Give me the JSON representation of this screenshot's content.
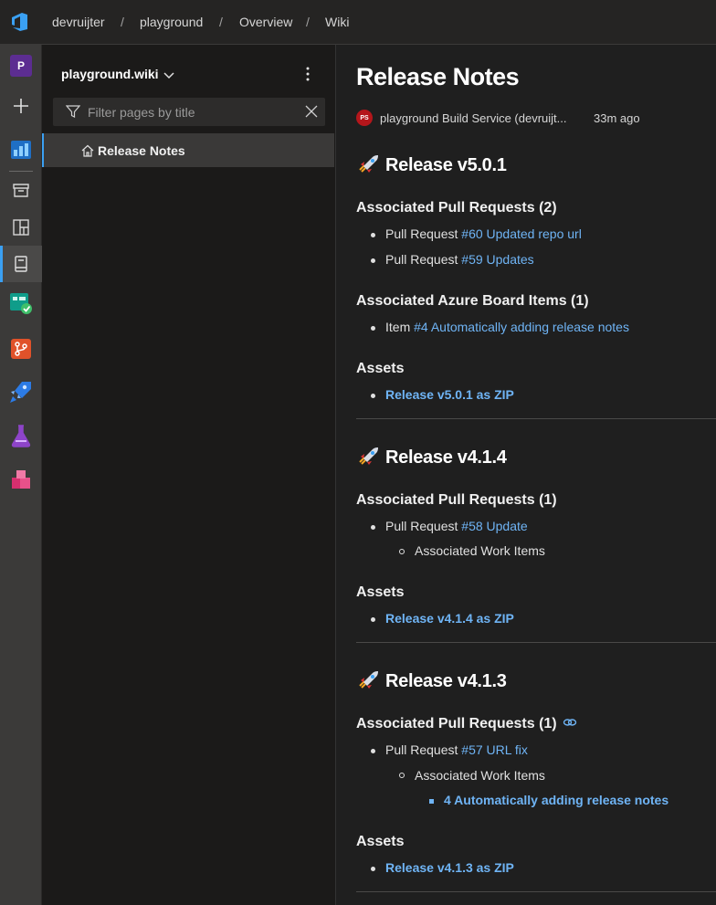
{
  "breadcrumb": [
    "devruijter",
    "playground",
    "Overview",
    "Wiki"
  ],
  "breadcrumb_sep": "/",
  "sidebar": {
    "project_initial": "P",
    "wiki_name": "playground.wiki",
    "filter_placeholder": "Filter pages by title",
    "pages": [
      {
        "label": "Release Notes"
      }
    ]
  },
  "page": {
    "title": "Release Notes",
    "author_initials": "PS",
    "author": "playground Build Service (devruijt...",
    "updated": "33m ago",
    "releases": [
      {
        "heading": "Release v5.0.1",
        "pr_heading": "Associated Pull Requests (2)",
        "prs": [
          {
            "prefix": "Pull Request",
            "link": "#60 Updated repo url"
          },
          {
            "prefix": "Pull Request",
            "link": "#59 Updates"
          }
        ],
        "board_heading": "Associated Azure Board Items (1)",
        "board_items": [
          {
            "prefix": "Item",
            "link": "#4 Automatically adding release notes"
          }
        ],
        "assets_heading": "Assets",
        "asset": "Release v5.0.1 as ZIP"
      },
      {
        "heading": "Release v4.1.4",
        "pr_heading": "Associated Pull Requests (1)",
        "prs": [
          {
            "prefix": "Pull Request",
            "link": "#58 Update"
          }
        ],
        "work_items_label": "Associated Work Items",
        "assets_heading": "Assets",
        "asset": "Release v4.1.4 as ZIP"
      },
      {
        "heading": "Release v4.1.3",
        "pr_heading": "Associated Pull Requests (1)",
        "prs": [
          {
            "prefix": "Pull Request",
            "link": "#57 URL fix"
          }
        ],
        "work_items_label": "Associated Work Items",
        "work_item_link": "4 Automatically adding release notes",
        "assets_heading": "Assets",
        "asset": "Release v4.1.3 as ZIP"
      }
    ]
  },
  "colors": {
    "accent": "#3aa0f3",
    "link": "#6fb4f5",
    "background": "#1f1f1f"
  }
}
